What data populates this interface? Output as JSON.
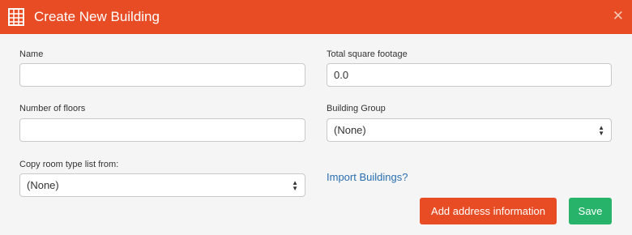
{
  "dialog": {
    "title": "Create New Building",
    "header_color": "#e84c24"
  },
  "form": {
    "name": {
      "label": "Name",
      "value": ""
    },
    "total_square_footage": {
      "label": "Total square footage",
      "value": "0.0"
    },
    "number_of_floors": {
      "label": "Number of floors",
      "value": ""
    },
    "building_group": {
      "label": "Building Group",
      "selected": "(None)"
    },
    "copy_room_type": {
      "label": "Copy room type list from:",
      "selected": "(None)"
    }
  },
  "import_link": "Import Buildings?",
  "buttons": {
    "add_address": "Add address information",
    "save": "Save"
  },
  "icons": {
    "building": "building-icon",
    "close": "close-icon"
  }
}
